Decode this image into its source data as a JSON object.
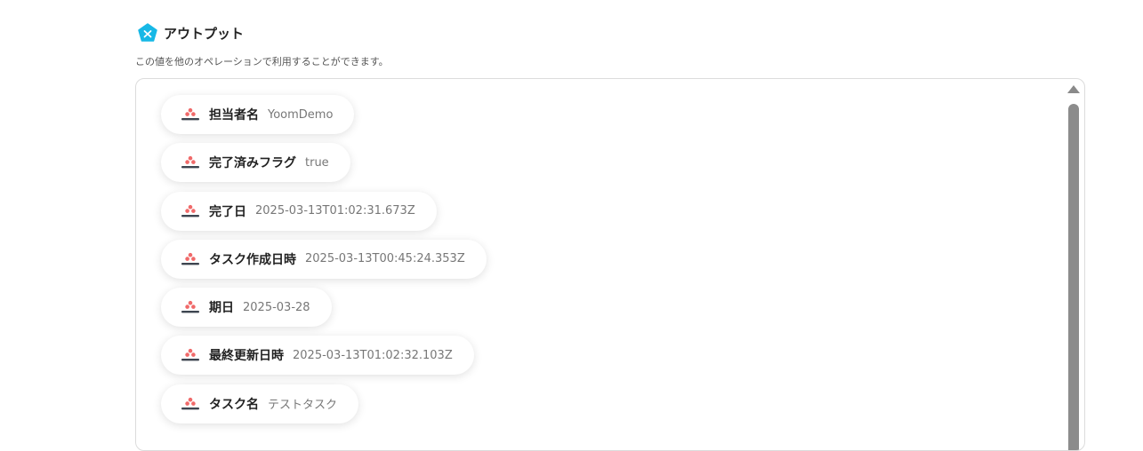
{
  "header": {
    "title": "アウトプット",
    "icon": "yoom-pentagon-icon",
    "icon_color": "#17b8e6"
  },
  "subtitle": "この値を他のオペレーションで利用することができます。",
  "fields": [
    {
      "name": "担当者名",
      "value": "YoomDemo",
      "source_icon": "asana-icon"
    },
    {
      "name": "完了済みフラグ",
      "value": "true",
      "source_icon": "asana-icon"
    },
    {
      "name": "完了日",
      "value": "2025-03-13T01:02:31.673Z",
      "source_icon": "asana-icon"
    },
    {
      "name": "タスク作成日時",
      "value": "2025-03-13T00:45:24.353Z",
      "source_icon": "asana-icon"
    },
    {
      "name": "期日",
      "value": "2025-03-28",
      "source_icon": "asana-icon"
    },
    {
      "name": "最終更新日時",
      "value": "2025-03-13T01:02:32.103Z",
      "source_icon": "asana-icon"
    },
    {
      "name": "タスク名",
      "value": "テストタスク",
      "source_icon": "asana-icon"
    }
  ],
  "colors": {
    "asana": "#f06a6a",
    "scrollbar": "#8c8c8c"
  }
}
